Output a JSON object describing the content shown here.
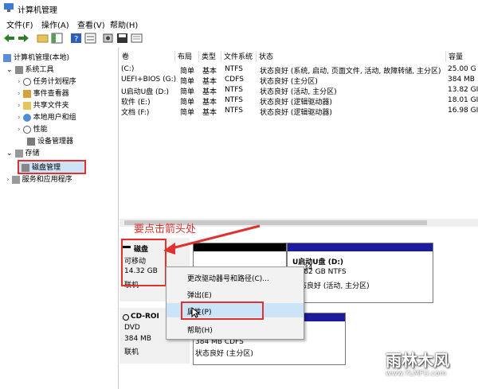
{
  "window": {
    "title": "计算机管理"
  },
  "menu": [
    "文件(F)",
    "操作(A)",
    "查看(V)",
    "帮助(H)"
  ],
  "tree": {
    "root": "计算机管理(本地)",
    "system_tools": "系统工具",
    "items": [
      "任务计划程序",
      "事件查看器",
      "共享文件夹",
      "本地用户和组",
      "性能",
      "设备管理器"
    ],
    "storage": "存储",
    "disk_mgmt": "磁盘管理",
    "services": "服务和应用程序"
  },
  "table": {
    "headers": [
      "卷",
      "布局",
      "类型",
      "文件系统",
      "状态",
      "容量"
    ],
    "rows": [
      [
        "(C:)",
        "简单",
        "基本",
        "NTFS",
        "状态良好 (系统, 启动, 页面文件, 活动, 故障转储, 主分区)",
        "25.00 G"
      ],
      [
        "UEFI+BIOS (G:)",
        "简单",
        "基本",
        "CDFS",
        "状态良好 (主分区)",
        "384 MB"
      ],
      [
        "U启动U盘 (D:)",
        "简单",
        "基本",
        "NTFS",
        "状态良好 (活动, 主分区)",
        "13.82 GI"
      ],
      [
        "软件 (E:)",
        "简单",
        "基本",
        "NTFS",
        "状态良好 (逻辑驱动器)",
        "18.01 GI"
      ],
      [
        "文档 (F:)",
        "简单",
        "基本",
        "NTFS",
        "状态良好 (逻辑驱动器)",
        "16.98 GI"
      ]
    ]
  },
  "annotation": "要点击箭头处",
  "disk1": {
    "name": "磁盘",
    "type": "可移动",
    "size": "14.32 GB",
    "status": "联机"
  },
  "disk1_part": {
    "name": "U启动U盘 (D:)",
    "size": "13.82 GB NTFS",
    "status": "状态良好 (活动, 主分区)",
    "left_size": "34"
  },
  "cdrom": {
    "name": "CD-ROI",
    "type": "DVD",
    "size": "384 MB",
    "status": "联机"
  },
  "cdrom_part": {
    "size": "384 MB CDFS",
    "status": "状态良好 (主分区)"
  },
  "context_menu": [
    "更改驱动器号和路径(C)...",
    "弹出(E)",
    "属性(P)",
    "帮助(H)"
  ],
  "watermark": {
    "brand": "雨林木风",
    "url": "www.YLMFU.com"
  },
  "colors": {
    "accent": "#e0312f",
    "partition_blue": "#1c1c9c",
    "partition_black": "#000000",
    "selection": "#cce4f7"
  }
}
